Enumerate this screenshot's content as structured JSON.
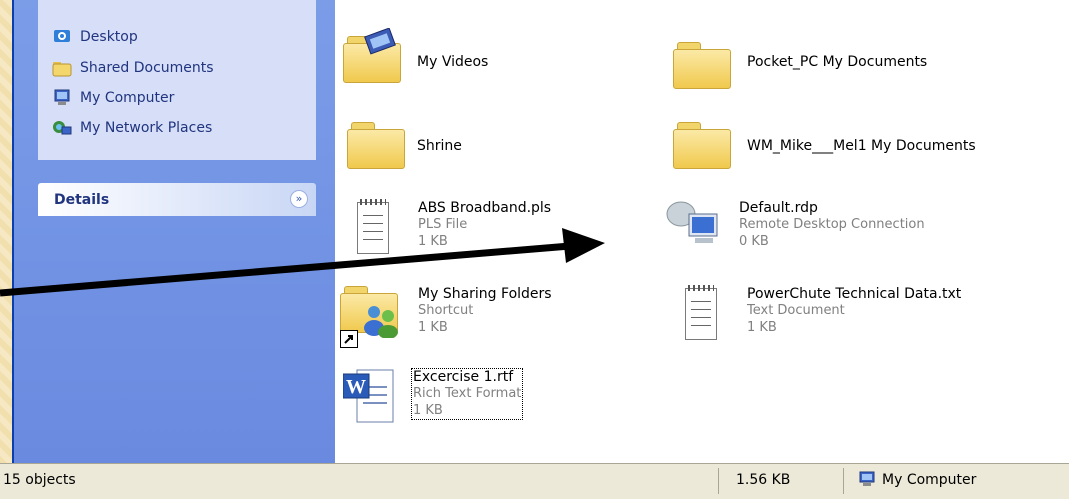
{
  "sidebar": {
    "places": [
      {
        "label": "Desktop",
        "icon": "desktop-icon"
      },
      {
        "label": "Shared Documents",
        "icon": "folder-icon"
      },
      {
        "label": "My Computer",
        "icon": "computer-icon"
      },
      {
        "label": "My Network Places",
        "icon": "network-icon"
      }
    ],
    "details_label": "Details"
  },
  "files": [
    {
      "name": "My Videos"
    },
    {
      "name": "Pocket_PC My Documents"
    },
    {
      "name": "Shrine"
    },
    {
      "name": "WM_Mike___Mel1 My Documents"
    },
    {
      "name": "ABS Broadband.pls",
      "type": "PLS File",
      "size": "1 KB"
    },
    {
      "name": "Default.rdp",
      "type": "Remote Desktop Connection",
      "size": "0 KB"
    },
    {
      "name": "My Sharing Folders",
      "type": "Shortcut",
      "size": "1 KB"
    },
    {
      "name": "PowerChute Technical Data.txt",
      "type": "Text Document",
      "size": "1 KB"
    },
    {
      "name": "Excercise 1.rtf",
      "type": "Rich Text Format",
      "size": "1 KB"
    }
  ],
  "status": {
    "count": "15 objects",
    "size": "1.56 KB",
    "location": "My Computer"
  },
  "colors": {
    "sidebar": "#6a8ae0",
    "window_border": "#0a3fb0",
    "annotation_arrow": "#000000"
  }
}
